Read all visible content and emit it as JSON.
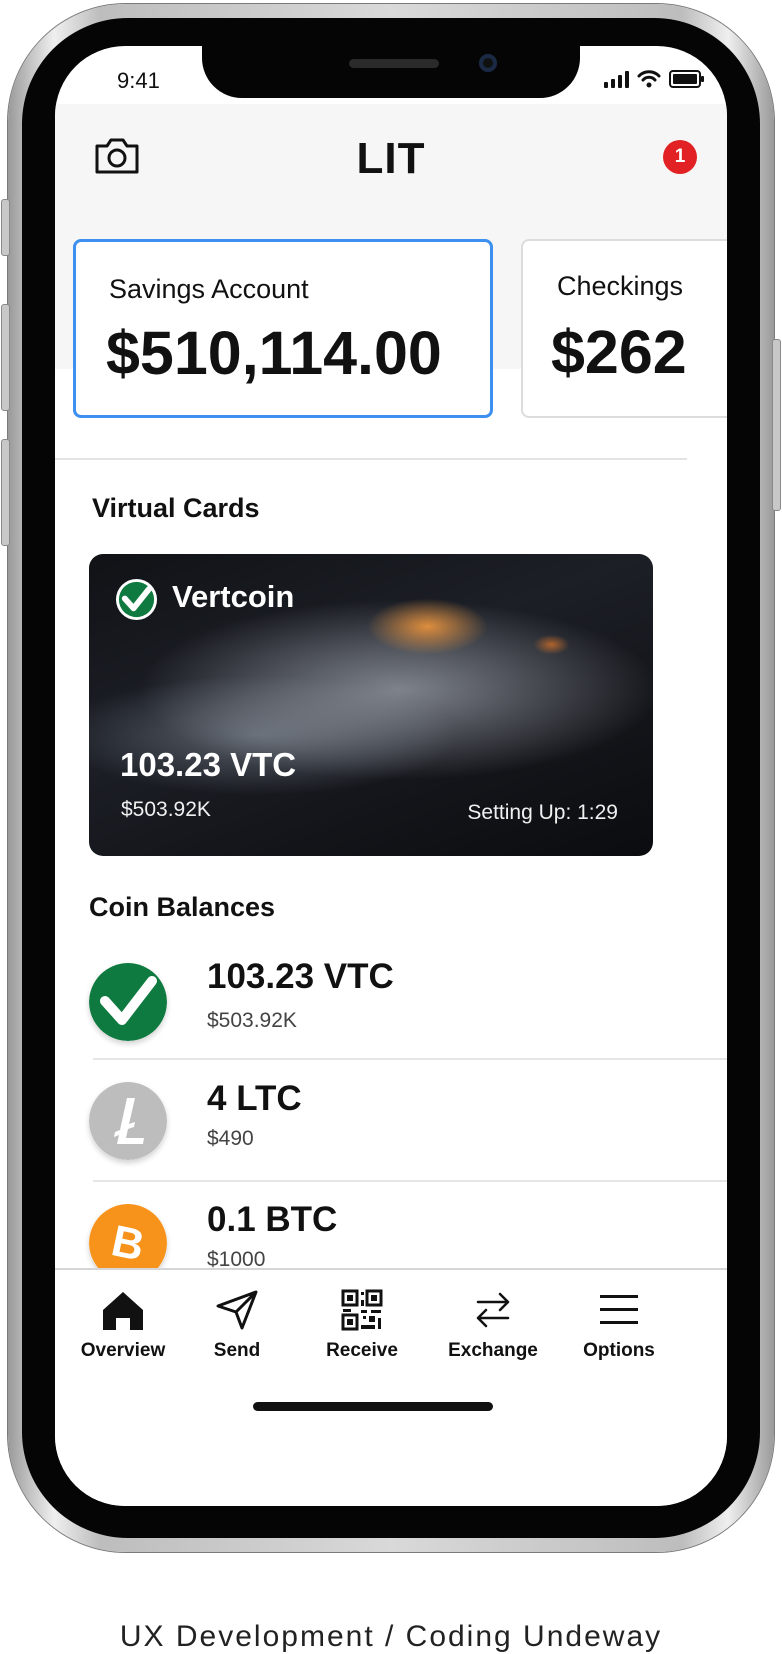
{
  "status_bar": {
    "time": "9:41"
  },
  "header": {
    "title": "LIT",
    "notification_count": "1"
  },
  "accounts": [
    {
      "name": "Savings Account",
      "amount": "$510,114.00",
      "selected": true
    },
    {
      "name": "Checkings",
      "amount": "$262",
      "selected": false
    }
  ],
  "virtual_cards": {
    "title": "Virtual Cards",
    "card": {
      "coin_name": "Vertcoin",
      "amount": "103.23 VTC",
      "fiat": "$503.92K",
      "status": "Setting Up: 1:29"
    }
  },
  "coin_balances": {
    "title": "Coin Balances",
    "items": [
      {
        "amount": "103.23 VTC",
        "fiat": "$503.92K",
        "icon": "vertcoin-icon",
        "color": "#0f7a40"
      },
      {
        "amount": "4 LTC",
        "fiat": "$490",
        "icon": "litecoin-icon",
        "color": "#bdbdbd"
      },
      {
        "amount": "0.1 BTC",
        "fiat": "$1000",
        "icon": "bitcoin-icon",
        "color": "#f7931a"
      }
    ]
  },
  "tab_bar": {
    "items": [
      {
        "label": "Overview",
        "icon": "home-icon"
      },
      {
        "label": "Send",
        "icon": "send-icon"
      },
      {
        "label": "Receive",
        "icon": "qr-code-icon"
      },
      {
        "label": "Exchange",
        "icon": "exchange-icon"
      },
      {
        "label": "Options",
        "icon": "menu-icon"
      }
    ]
  },
  "colors": {
    "accent": "#3d8ff0",
    "badge": "#e12124"
  },
  "caption": "UX Development / Coding Undeway"
}
